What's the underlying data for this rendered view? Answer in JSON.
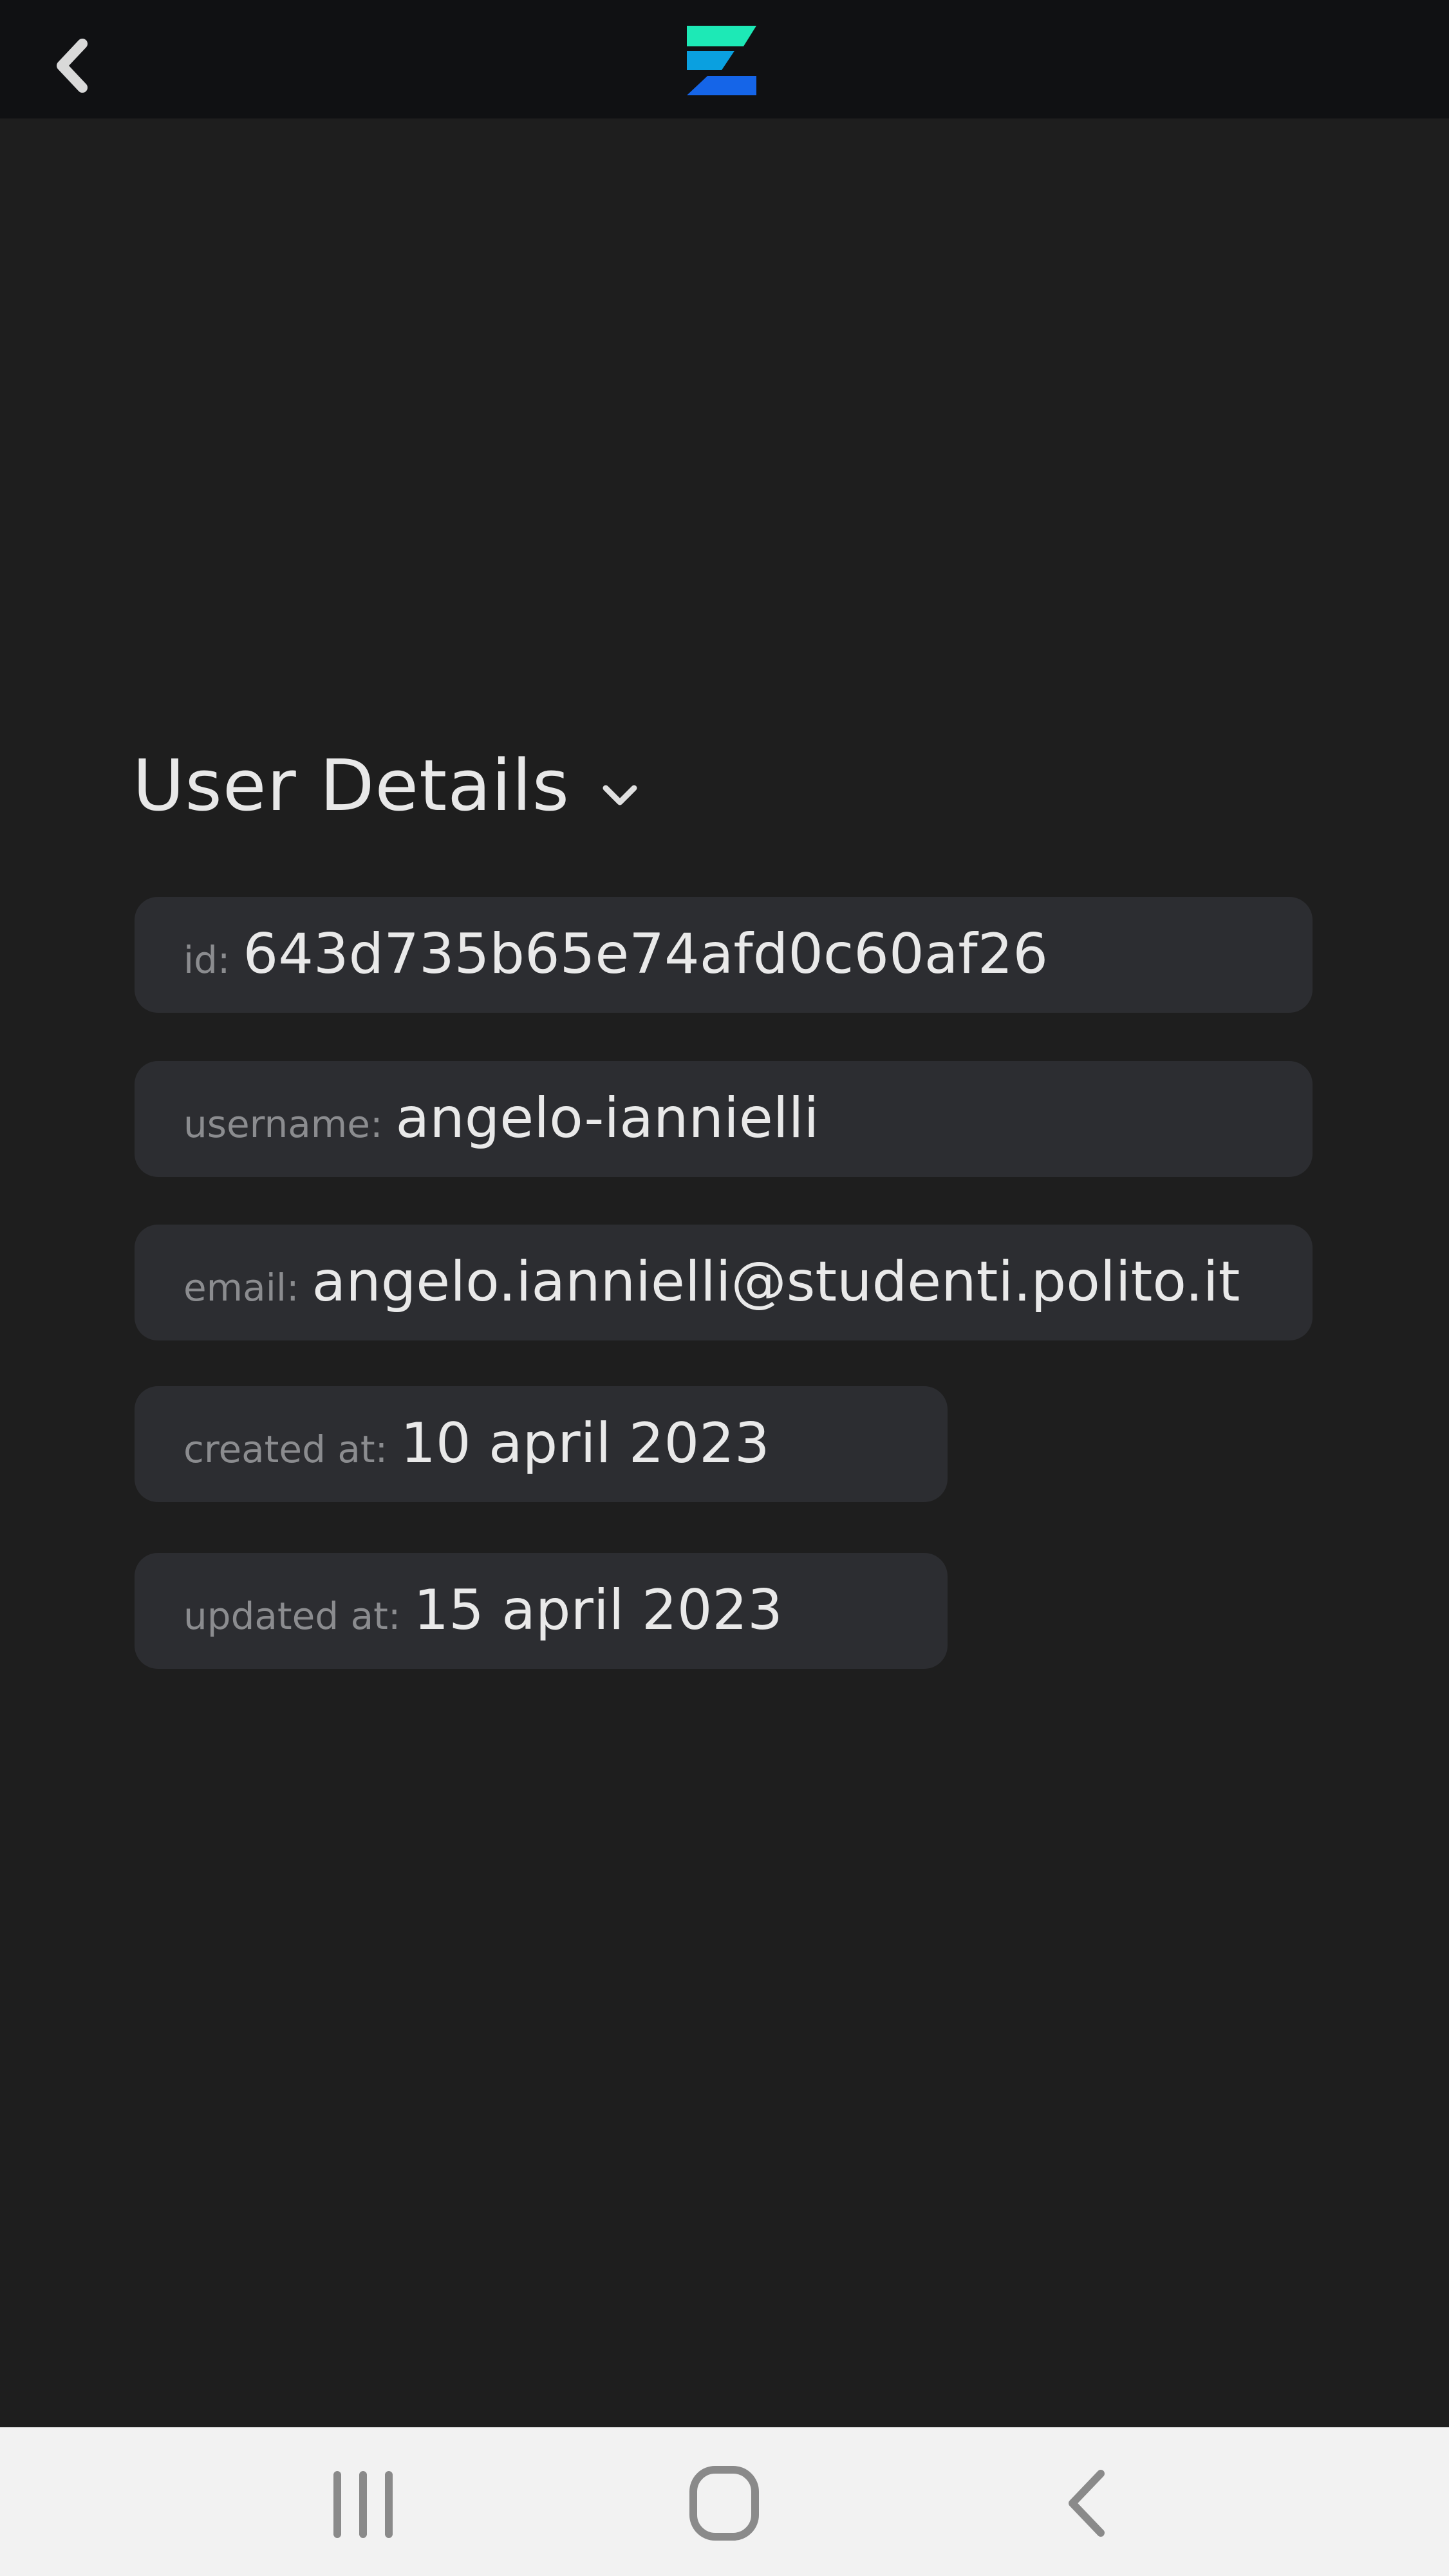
{
  "header": {
    "back_icon": "chevron-left-icon",
    "logo_icon": "z-logo-icon",
    "logo_colors": [
      "#1de9b6",
      "#0aa0e0",
      "#1565e8"
    ]
  },
  "section": {
    "title": "User Details",
    "toggle_icon": "chevron-down-icon"
  },
  "fields": {
    "id": {
      "label": "id:",
      "value": "643d735b65e74afd0c60af26"
    },
    "username": {
      "label": "username:",
      "value": "angelo-iannielli"
    },
    "email": {
      "label": "email:",
      "value": "angelo.iannielli@studenti.polito.it"
    },
    "created_at": {
      "label": "created at:",
      "value": "10 april 2023"
    },
    "updated_at": {
      "label": "updated at:",
      "value": "15 april 2023"
    }
  },
  "navbar": {
    "recents_icon": "recent-apps-icon",
    "home_icon": "home-icon",
    "back_icon": "back-icon"
  }
}
